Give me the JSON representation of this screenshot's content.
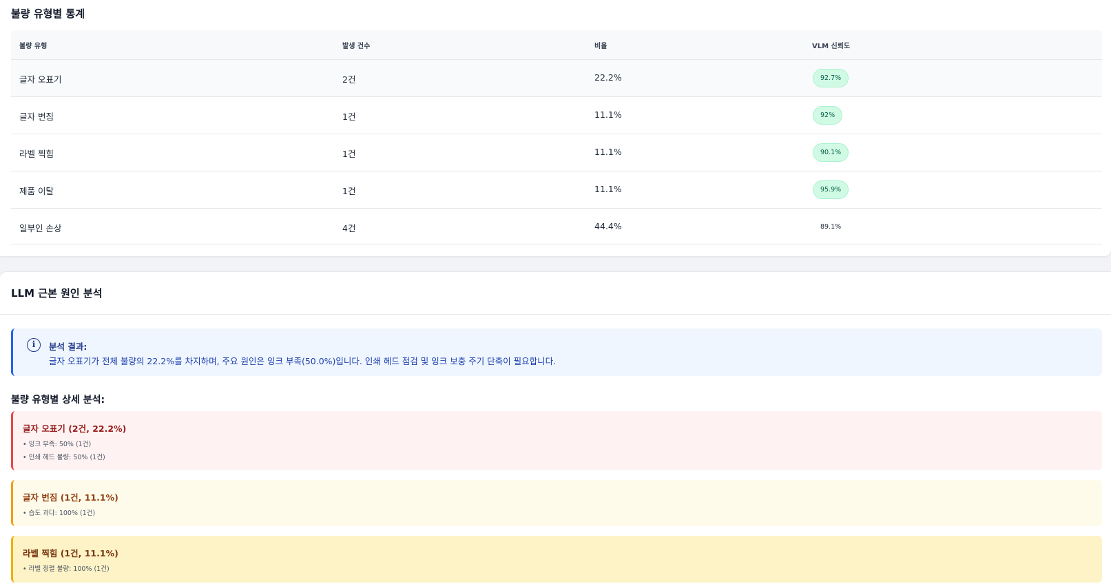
{
  "stats": {
    "title": "불량 유형별 통계",
    "headers": [
      "불량 유형",
      "발생 건수",
      "비율",
      "VLM 신뢰도"
    ],
    "rows": [
      {
        "type": "글자 오표기",
        "count": "2건",
        "ratio": "22.2%",
        "confidence": "92.7%"
      },
      {
        "type": "글자 번짐",
        "count": "1건",
        "ratio": "11.1%",
        "confidence": "92%"
      },
      {
        "type": "라벨 찍힘",
        "count": "1건",
        "ratio": "11.1%",
        "confidence": "90.1%"
      },
      {
        "type": "제품 이탈",
        "count": "1건",
        "ratio": "11.1%",
        "confidence": "95.9%"
      },
      {
        "type": "일부인 손상",
        "count": "4건",
        "ratio": "44.4%",
        "confidence": "89.1%"
      }
    ]
  },
  "llm": {
    "title": "LLM 근본 원인 분석",
    "info_icon": "i",
    "info_title": "분석 결과:",
    "info_text": "글자 오표기가 전체 불량의 22.2%를 차지하며, 주요 원인은 잉크 부족(50.0%)입니다. 인쇄 헤드 점검 및 잉크 보충 주기 단축이 필요합니다.",
    "detail_title": "불량 유형별 상세 분석:",
    "details": [
      {
        "title": "글자 오표기 (2건, 22.2%)",
        "items": [
          "• 잉크 부족: 50% (1건)",
          "• 인쇄 헤드 불량: 50% (1건)"
        ]
      },
      {
        "title": "글자 번짐 (1건, 11.1%)",
        "items": [
          "• 습도 과다: 100% (1건)"
        ]
      },
      {
        "title": "라벨 찍힘 (1건, 11.1%)",
        "items": [
          "• 라벨 정렬 불량: 100% (1건)"
        ]
      }
    ]
  },
  "colors": {
    "badge_bg": "#d1fae5",
    "info_accent": "#2563eb",
    "detail_red": "#ef4444",
    "detail_orange": "#f59e0b",
    "detail_yellow": "#eab308"
  }
}
